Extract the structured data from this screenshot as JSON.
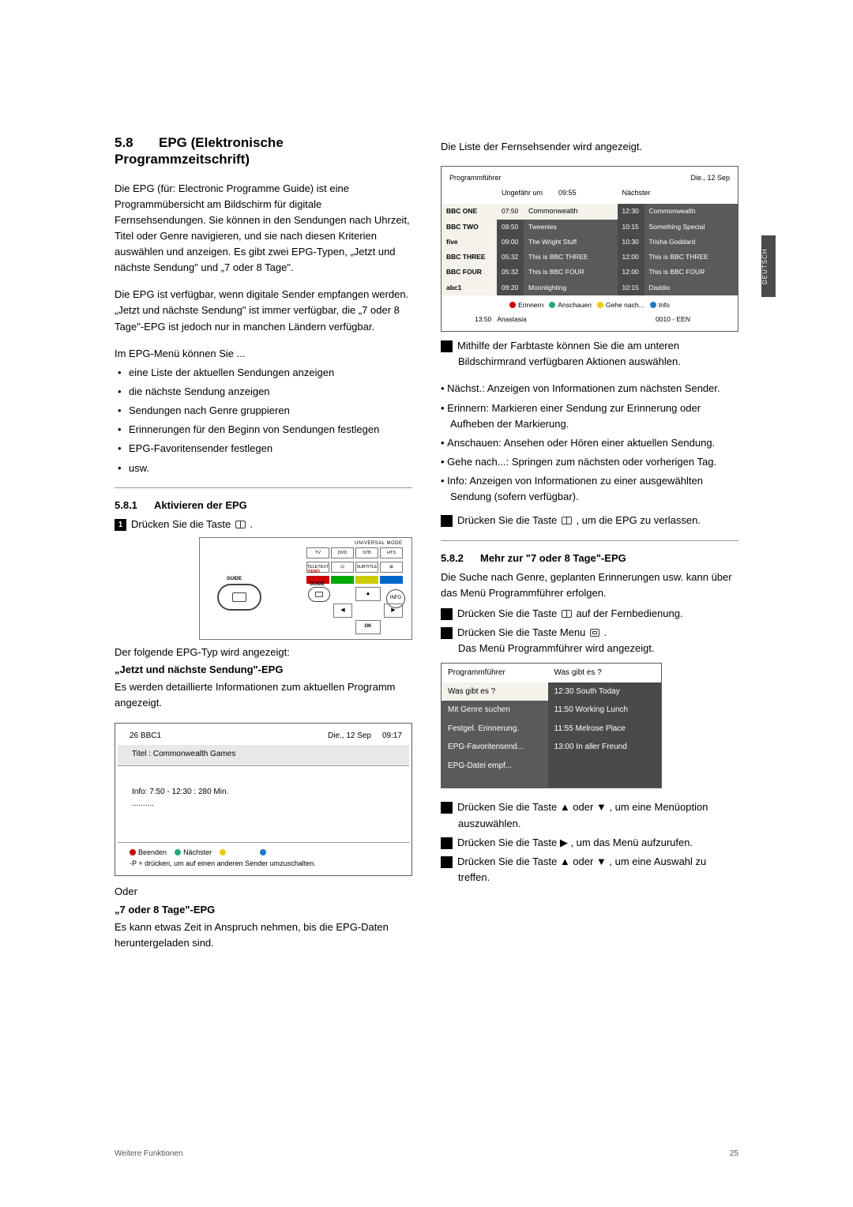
{
  "header": {
    "section_number": "5.8",
    "section_title": "EPG (Elektronische Programmzeitschrift)"
  },
  "col1": {
    "p1": "Die EPG (für: Electronic Programme Guide) ist eine Programmübersicht am Bildschirm für digitale Fernsehsendungen. Sie können in den Sendungen nach Uhrzeit, Titel oder Genre navigieren, und sie nach diesen Kriterien auswählen und anzeigen. Es gibt zwei EPG-Typen, „Jetzt und nächste Sendung\" und „7 oder 8 Tage\".",
    "p2a": "Die EPG ist verfügbar, wenn digitale Sender empfangen werden. ",
    "p2b": "„Jetzt und nächste Sendung\"",
    "p2c": " ist immer verfügbar, die ",
    "p2d": "„7 oder 8 Tage\"",
    "p2e": "-EPG ist jedoch nur in manchen Ländern verfügbar.",
    "p3": "Im EPG-Menü können Sie ...",
    "li1": "eine Liste der aktuellen Sendungen anzeigen",
    "li2": "die nächste Sendung anzeigen",
    "li3": "Sendungen nach Genre gruppieren",
    "li4": "Erinnerungen für den Beginn von Sendungen festlegen",
    "li5": "EPG-Favoritensender festlegen",
    "li6": "usw.",
    "sub1_num": "5.8.1",
    "sub1_title": "Aktivieren der EPG",
    "step1": "Drücken Sie die Taste ",
    "remote": {
      "universal": "UNIVERSAL MODE",
      "k1": "TV",
      "k2": "DVD",
      "k3": "STB",
      "k4": "HTS",
      "r1": "TELETEXT",
      "r4": "SUBTITLE",
      "guide_label_big": "GUIDE",
      "guide_label_small": "GUIDE",
      "info": "INFO",
      "ok": "OK",
      "demo": "DEMO"
    },
    "after_remote_1": "Der folgende EPG-Typ wird angezeigt:",
    "after_remote_h1": "„Jetzt und nächste Sendung\"-EPG",
    "after_remote_2": "Es werden detaillierte Informationen zum aktuellen Programm angezeigt.",
    "screen1": {
      "ch": "26  BBC1",
      "date": "Die., 12 Sep",
      "time": "09:17",
      "title": "Titel : Commonwealth Games",
      "info": "Info: 7:50 - 12:30 : 280 Min.",
      "ellipsis": "..........",
      "f_beenden": "Beenden",
      "f_nachster": "Nächster",
      "f_tip": "-P + drücken, um auf einen anderen Sender umzuschalten."
    },
    "oder": "Oder",
    "after_screen_h2": "„7 oder 8 Tage\"-EPG",
    "after_screen_2": "Es kann etwas Zeit in Anspruch nehmen, bis die EPG-Daten heruntergeladen sind."
  },
  "col2": {
    "p1": "Die Liste der Fernsehsender wird angezeigt.",
    "epg": {
      "title": "Programmführer",
      "date": "Die., 12 Sep",
      "col_a": "Ungefähr um",
      "col_a_time": "09:55",
      "col_b": "Nächster",
      "rows": [
        {
          "ch": "BBC ONE",
          "t1": "07:50",
          "p1": "Commonwealth",
          "t2": "12:30",
          "p2": "Commonwealth",
          "white": true
        },
        {
          "ch": "BBC TWO",
          "t1": "09:50",
          "p1": "Tweenies",
          "t2": "10:15",
          "p2": "Something Special"
        },
        {
          "ch": "five",
          "t1": "09:00",
          "p1": "The Wright Stuff",
          "t2": "10:30",
          "p2": "Trisha Goddard"
        },
        {
          "ch": "BBC THREE",
          "t1": "05:32",
          "p1": "This is BBC THREE",
          "t2": "12:00",
          "p2": "This is BBC THREE"
        },
        {
          "ch": "BBC FOUR",
          "t1": "05:32",
          "p1": "This is BBC FOUR",
          "t2": "12:00",
          "p2": "This is BBC FOUR"
        },
        {
          "ch": "abc1",
          "t1": "09:20",
          "p1": "Moonlighting",
          "t2": "10:15",
          "p2": "Daddio"
        }
      ],
      "ftr_erinnern": "Erinnern",
      "ftr_anschauen": "Anschauen",
      "ftr_gehe": "Gehe nach...",
      "ftr_info": "Info",
      "ftr_time": "13:50",
      "ftr_prog": "Anastasia",
      "ftr_right": "0010 - EEN"
    },
    "step2": "Mithilfe der Farbtaste können Sie die am unteren Bildschirmrand verfügbaren Aktionen auswählen.",
    "d1k": "Nächst.",
    "d1v": ": Anzeigen von Informationen zum nächsten Sender.",
    "d2k": "Erinnern",
    "d2v": ": Markieren einer Sendung zur Erinnerung oder Aufheben der Markierung.",
    "d3k": "Anschauen",
    "d3v": ": Ansehen oder Hören einer aktuellen Sendung.",
    "d4k": "Gehe nach...",
    "d4v": ": Springen zum nächsten oder vorherigen Tag.",
    "d5k": "Info",
    "d5v": ": Anzeigen von Informationen zu einer ausgewählten Sendung (sofern verfügbar).",
    "step3a": "Drücken Sie die Taste ",
    "step3b": " , um die EPG zu verlassen.",
    "sub2_num": "5.8.2",
    "sub2_title": "Mehr zur \"7 oder 8 Tage\"-EPG",
    "p3": "Die Suche nach Genre, geplanten Erinnerungen usw. kann über das Menü Programmführer erfolgen.",
    "step_m1a": "Drücken Sie die Taste ",
    "step_m1b": " auf der Fernbedienung.",
    "step_m2a": "Drücken Sie die Taste ",
    "step_m2b": "Menu",
    "step_m2c": " .",
    "step_m2d": "Das Menü Programmführer wird angezeigt.",
    "menu": {
      "h_left": "Programmführer",
      "h_right": "Was gibt es ?",
      "rows": [
        {
          "l": "Was gibt es ?",
          "r": "12:30 South Today",
          "w": true
        },
        {
          "l": "Mit Genre suchen",
          "r": "11:50 Working Lunch"
        },
        {
          "l": "Festgel. Erinnerung.",
          "r": "11:55 Melrose Place"
        },
        {
          "l": "EPG-Favoritensend...",
          "r": "13:00 In aller Freund"
        },
        {
          "l": "EPG-Datei empf...",
          "r": ""
        },
        {
          "l": "",
          "r": ""
        },
        {
          "l": "",
          "r": ""
        }
      ]
    },
    "step_m3": "Drücken Sie die Taste  ▲  oder  ▼ , um eine Menüoption auszuwählen.",
    "step_m4": "Drücken Sie die Taste  ▶ , um das Menü aufzurufen.",
    "step_m5": "Drücken Sie die Taste  ▲  oder  ▼ , um eine Auswahl zu treffen."
  },
  "sidetab": "DEUTSCH",
  "footer": {
    "left": "Weitere Funktionen",
    "right": "25"
  }
}
